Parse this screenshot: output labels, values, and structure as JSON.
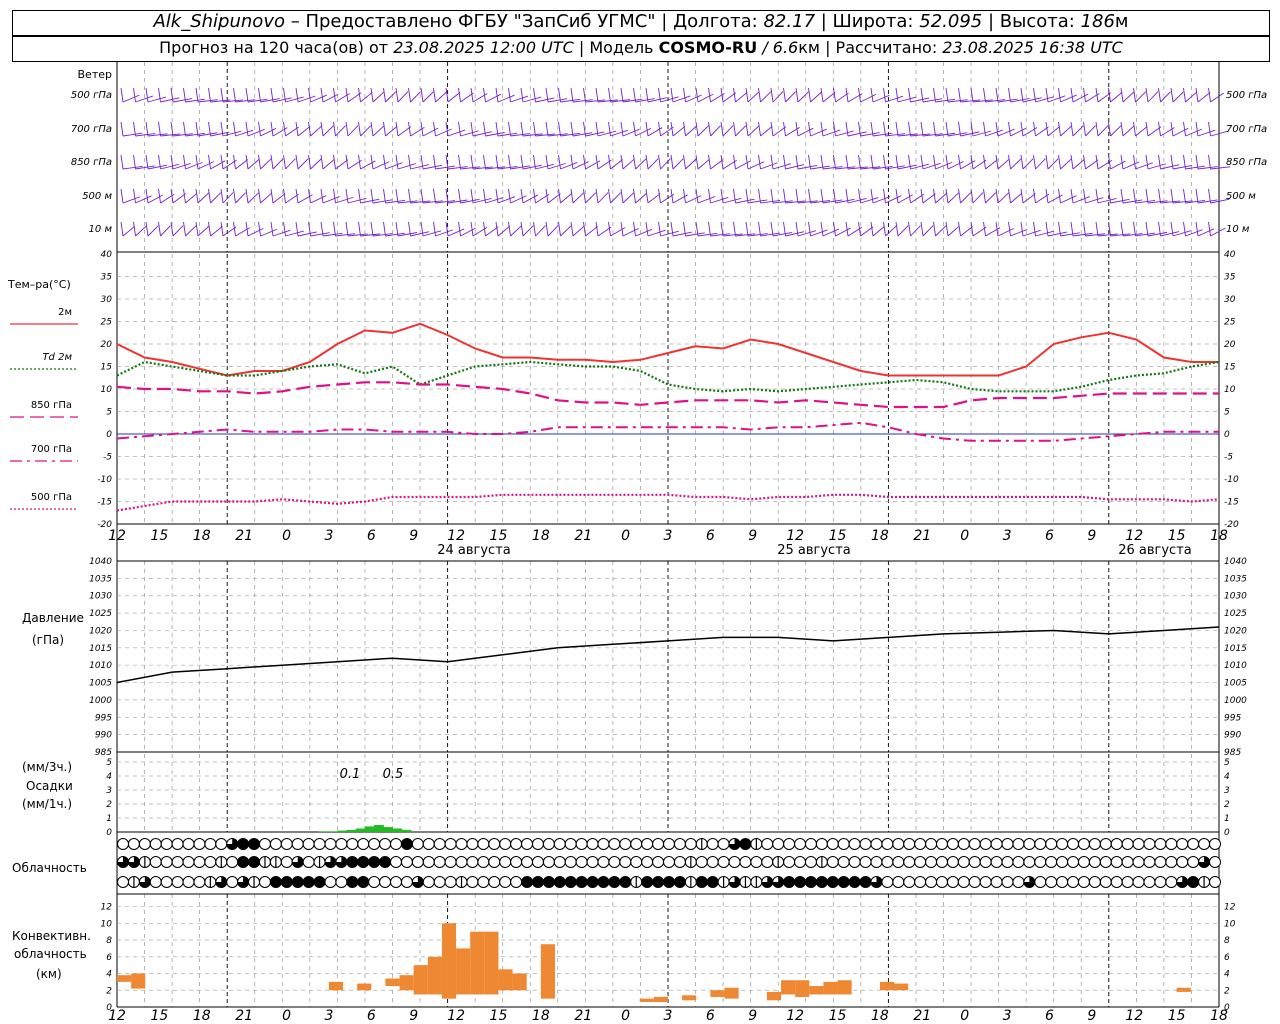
{
  "header": {
    "station": "Alk_Shipunovo",
    "provider": "– Предоставлено ФГБУ \"ЗапСиб УГМС\" |",
    "lon_label": "Долгота:",
    "lon": "82.17",
    "lat_label": "| Широта:",
    "lat": "52.095",
    "alt_label": "| Высота:",
    "alt": "186",
    "alt_unit": "м",
    "forecast_label": "Прогноз на 120 часа(ов) от",
    "forecast_start": "23.08.2025 12:00 UTC",
    "model_label": "| Модель",
    "model": "COSMO-RU",
    "resolution": "/ 6.6",
    "res_unit": "км",
    "calc_label": "| Рассчитано:",
    "calc_time": "23.08.2025 16:38 UTC"
  },
  "labels": {
    "wind_title": "Ветер",
    "wind_levels": [
      "500 гПа",
      "700 гПа",
      "850 гПа",
      "500 м",
      "10  м"
    ],
    "temp_title": "Тем–ра(°C)",
    "temp_series": [
      "2м",
      "Td  2м",
      "850 гПа",
      "700 гПа",
      "500 гПа"
    ],
    "pressure_title": "Давление",
    "pressure_unit": "(гПа)",
    "precip_unit3": "(мм/3ч.)",
    "precip_title": "Осадки",
    "precip_unit1": "(мм/1ч.)",
    "cloud_title": "Облачность",
    "conv_title1": "Конвективн.",
    "conv_title2": "облачность",
    "conv_unit": "(км)",
    "precip_annotations": [
      "0.1",
      "0.5"
    ]
  },
  "colors": {
    "t2m": "#ee3333",
    "td2m": "#117711",
    "t850": "#dd1188",
    "t700": "#dd1188",
    "t500": "#dd1188",
    "wind": "#7722cc",
    "pressure": "#000000",
    "precip": "#22bb22",
    "convective": "#ee8833"
  },
  "chart_data": [
    {
      "type": "line",
      "name": "temperature",
      "x_hours": [
        0,
        3,
        6,
        9,
        12,
        15,
        18,
        21,
        24,
        27,
        30,
        33,
        36,
        39,
        42,
        45,
        48,
        51,
        54,
        57,
        60,
        63,
        66,
        69,
        72,
        75,
        78,
        81,
        84,
        87,
        90,
        93,
        96,
        99,
        102,
        105,
        108,
        111,
        114,
        117,
        120
      ],
      "x_tick_labels": [
        "12",
        "15",
        "18",
        "21",
        "0",
        "3",
        "6",
        "9",
        "12",
        "15",
        "18",
        "21",
        "0",
        "3",
        "6",
        "9",
        "12",
        "15",
        "18",
        "21",
        "0",
        "3",
        "6",
        "9",
        "12",
        "15",
        "18"
      ],
      "date_labels": [
        "24 августа",
        "25 августа",
        "26 августа"
      ],
      "ylim": [
        -20,
        40
      ],
      "yticks": [
        -20,
        -15,
        -10,
        -5,
        0,
        5,
        10,
        15,
        20,
        25,
        30,
        35,
        40
      ],
      "series": [
        {
          "name": "2м",
          "values": [
            20,
            17,
            16,
            14.5,
            13,
            14,
            14,
            16,
            20,
            23,
            22.5,
            24.5,
            22,
            19,
            17,
            17,
            16.5,
            16.5,
            16,
            16.5,
            18,
            19.5,
            19,
            21,
            20,
            18,
            16,
            14,
            13,
            13,
            13,
            13,
            13,
            15,
            20,
            21.5,
            22.5,
            21,
            17,
            16,
            16
          ]
        },
        {
          "name": "Td  2м",
          "values": [
            13,
            16,
            15,
            14,
            13,
            13,
            14,
            15,
            15.5,
            13.5,
            15,
            11,
            13,
            15,
            15.5,
            16,
            15.5,
            15,
            15,
            14,
            11,
            10,
            9.5,
            10,
            9.5,
            10,
            10.5,
            11,
            11.5,
            12,
            11.5,
            10,
            9.5,
            9.5,
            9.5,
            10.5,
            12,
            13,
            13.5,
            15,
            16
          ]
        },
        {
          "name": "850 гПа",
          "values": [
            10.5,
            10,
            10,
            9.5,
            9.5,
            9,
            9.5,
            10.5,
            11,
            11.5,
            11.5,
            11,
            11,
            10.5,
            10,
            9,
            7.5,
            7,
            7,
            6.5,
            7,
            7.5,
            7.5,
            7.5,
            7,
            7.5,
            7,
            6.5,
            6,
            6,
            6,
            7.5,
            8,
            8,
            8,
            8.5,
            9,
            9,
            9,
            9,
            9
          ]
        },
        {
          "name": "700 гПа",
          "values": [
            -1,
            -0.5,
            0,
            0.5,
            1,
            0.5,
            0.5,
            0.5,
            1,
            1,
            0.5,
            0.5,
            0.5,
            0,
            0,
            0.5,
            1.5,
            1.5,
            1.5,
            1.5,
            1.5,
            1.5,
            1.5,
            1,
            1.5,
            1.5,
            2,
            2.5,
            1.5,
            0,
            -1,
            -1.5,
            -1.5,
            -1.5,
            -1.5,
            -1,
            -0.5,
            0,
            0.5,
            0.5,
            0.5
          ]
        },
        {
          "name": "500 гПа",
          "values": [
            -17,
            -16,
            -15,
            -15,
            -15,
            -15,
            -14.5,
            -15,
            -15.5,
            -15,
            -14,
            -14,
            -14,
            -14,
            -13.5,
            -13.5,
            -13.5,
            -13.5,
            -13.5,
            -13.5,
            -13.5,
            -14,
            -14,
            -14.5,
            -14,
            -14,
            -13.5,
            -13.5,
            -14,
            -14,
            -14,
            -14,
            -14,
            -14,
            -14,
            -14,
            -14.5,
            -14.5,
            -14.5,
            -15,
            -14.5
          ]
        }
      ]
    },
    {
      "type": "line",
      "name": "pressure",
      "ylim": [
        985,
        1040
      ],
      "yticks": [
        985,
        990,
        995,
        1000,
        1005,
        1010,
        1015,
        1020,
        1025,
        1030,
        1035,
        1040
      ],
      "x_hours": [
        0,
        6,
        12,
        18,
        24,
        30,
        36,
        42,
        48,
        54,
        60,
        66,
        72,
        78,
        84,
        90,
        96,
        102,
        108,
        114,
        120
      ],
      "values": [
        1005,
        1008,
        1009,
        1010,
        1011,
        1012,
        1011,
        1013,
        1015,
        1016,
        1017,
        1018,
        1018,
        1017,
        1018,
        1019,
        1019.5,
        1020,
        1019,
        1020,
        1021
      ]
    },
    {
      "type": "bar",
      "name": "precipitation",
      "ylim": [
        0,
        5
      ],
      "yticks": [
        0,
        1,
        2,
        3,
        4,
        5
      ],
      "x_hours": [
        22,
        23,
        24,
        25,
        26,
        27,
        28,
        29,
        30,
        31
      ],
      "values": [
        0.05,
        0.05,
        0.1,
        0.15,
        0.25,
        0.4,
        0.5,
        0.35,
        0.25,
        0.15
      ]
    },
    {
      "type": "bar",
      "name": "convective_cloud",
      "ylim": [
        0,
        13
      ],
      "yticks": [
        0,
        2,
        4,
        6,
        8,
        10,
        12
      ],
      "bars": [
        {
          "x": 0,
          "bottom": 3,
          "top": 3.8
        },
        {
          "x": 1,
          "bottom": 2.2,
          "top": 4
        },
        {
          "x": 15,
          "bottom": 2,
          "top": 3
        },
        {
          "x": 17,
          "bottom": 2,
          "top": 2.8
        },
        {
          "x": 19,
          "bottom": 2.5,
          "top": 3.4
        },
        {
          "x": 20,
          "bottom": 2,
          "top": 3.8
        },
        {
          "x": 21,
          "bottom": 1.5,
          "top": 5
        },
        {
          "x": 22,
          "bottom": 1.5,
          "top": 6
        },
        {
          "x": 23,
          "bottom": 1,
          "top": 10
        },
        {
          "x": 24,
          "bottom": 1.5,
          "top": 7
        },
        {
          "x": 25,
          "bottom": 1.5,
          "top": 9
        },
        {
          "x": 26,
          "bottom": 1.5,
          "top": 9
        },
        {
          "x": 27,
          "bottom": 2,
          "top": 4.5
        },
        {
          "x": 28,
          "bottom": 2,
          "top": 4
        },
        {
          "x": 30,
          "bottom": 1,
          "top": 7.5
        },
        {
          "x": 37,
          "bottom": 0.6,
          "top": 1
        },
        {
          "x": 38,
          "bottom": 0.6,
          "top": 1.2
        },
        {
          "x": 40,
          "bottom": 0.8,
          "top": 1.4
        },
        {
          "x": 42,
          "bottom": 1.2,
          "top": 2
        },
        {
          "x": 43,
          "bottom": 1,
          "top": 2.3
        },
        {
          "x": 46,
          "bottom": 0.8,
          "top": 1.8
        },
        {
          "x": 47,
          "bottom": 1.5,
          "top": 3.2
        },
        {
          "x": 48,
          "bottom": 1.2,
          "top": 3.2
        },
        {
          "x": 49,
          "bottom": 1.5,
          "top": 2.5
        },
        {
          "x": 50,
          "bottom": 1.5,
          "top": 3
        },
        {
          "x": 51,
          "bottom": 1.5,
          "top": 3.2
        },
        {
          "x": 54,
          "bottom": 2,
          "top": 3
        },
        {
          "x": 55,
          "bottom": 2,
          "top": 2.8
        },
        {
          "x": 75,
          "bottom": 1.8,
          "top": 2.3
        }
      ]
    }
  ],
  "cloud_rows": [
    [
      0,
      0,
      0,
      0,
      0,
      0,
      0,
      0,
      0,
      0,
      3,
      4,
      4,
      0,
      0,
      0,
      0,
      0,
      0,
      0,
      0,
      0,
      0,
      0,
      0,
      0,
      4,
      0,
      0,
      0,
      0,
      0,
      0,
      0,
      0,
      0,
      0,
      0,
      0,
      0,
      0,
      0,
      0,
      0,
      0,
      0,
      0,
      0,
      0,
      0,
      0,
      0,
      0,
      2,
      0,
      0,
      3,
      4,
      2,
      0,
      0,
      0,
      0,
      0,
      0,
      0,
      0,
      0,
      0,
      0,
      0,
      0,
      0,
      0,
      0,
      0,
      0,
      0,
      0,
      0,
      0,
      0,
      0,
      0,
      0,
      0,
      0,
      0,
      0,
      0,
      0,
      0,
      0,
      0,
      0,
      0,
      0,
      0,
      0,
      0,
      0,
      0
    ],
    [
      3,
      3,
      2,
      0,
      0,
      0,
      0,
      0,
      0,
      2,
      0,
      4,
      4,
      2,
      2,
      0,
      3,
      0,
      2,
      3,
      3,
      4,
      4,
      4,
      4,
      0,
      0,
      0,
      0,
      0,
      0,
      0,
      0,
      0,
      0,
      0,
      0,
      0,
      0,
      0,
      0,
      0,
      0,
      0,
      0,
      0,
      0,
      0,
      0,
      0,
      0,
      0,
      2,
      0,
      0,
      0,
      0,
      0,
      0,
      0,
      2,
      0,
      0,
      0,
      2,
      0,
      0,
      0,
      0,
      0,
      0,
      0,
      0,
      0,
      0,
      0,
      0,
      0,
      0,
      0,
      0,
      0,
      0,
      0,
      0,
      0,
      0,
      0,
      0,
      0,
      0,
      0,
      0,
      0,
      0,
      0,
      0,
      0,
      0,
      3,
      0,
      0
    ],
    [
      0,
      2,
      3,
      0,
      0,
      0,
      0,
      0,
      2,
      3,
      0,
      3,
      2,
      0,
      4,
      4,
      4,
      4,
      4,
      0,
      0,
      4,
      4,
      0,
      0,
      0,
      0,
      3,
      0,
      0,
      0,
      2,
      0,
      0,
      0,
      0,
      0,
      4,
      4,
      4,
      4,
      4,
      4,
      4,
      4,
      4,
      4,
      2,
      4,
      4,
      4,
      4,
      2,
      4,
      4,
      2,
      3,
      2,
      2,
      3,
      3,
      4,
      4,
      4,
      4,
      4,
      4,
      4,
      4,
      3,
      0,
      0,
      0,
      0,
      0,
      0,
      0,
      0,
      0,
      0,
      0,
      0,
      0,
      3,
      0,
      0,
      0,
      0,
      0,
      0,
      0,
      0,
      0,
      0,
      0,
      0,
      0,
      3,
      4,
      2,
      0,
      0
    ]
  ]
}
